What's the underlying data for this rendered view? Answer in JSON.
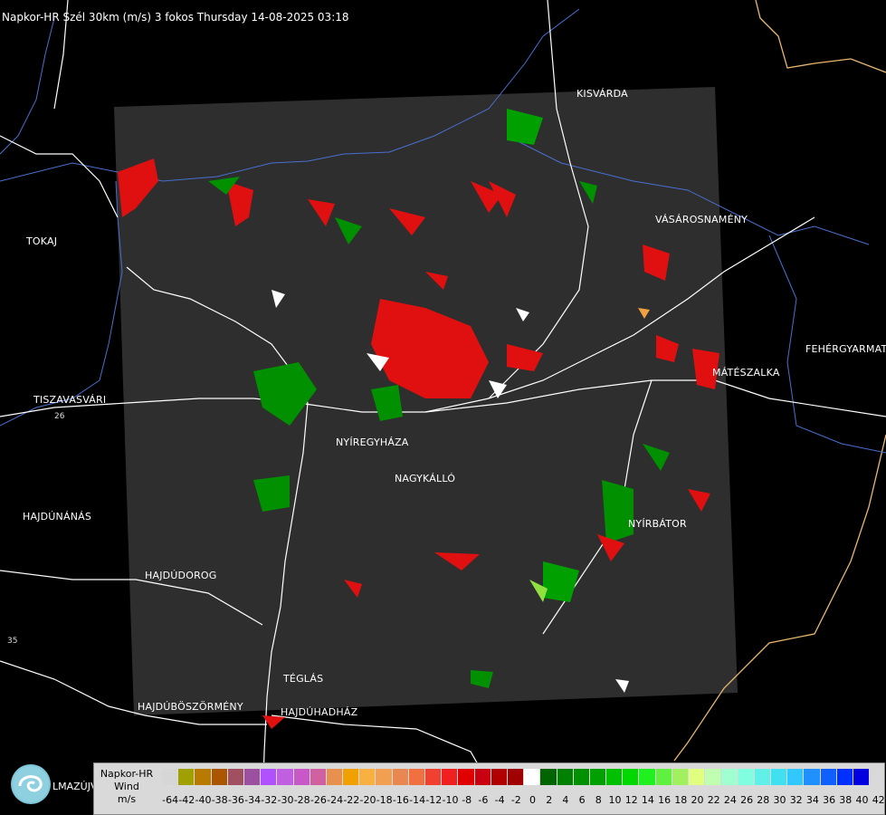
{
  "title": "Napkor-HR Szél 30km (m/s) 3 fokos Thursday 14-08-2025 03:18",
  "cities": [
    {
      "name": "KISVÁRDA"
    },
    {
      "name": "TOKAJ"
    },
    {
      "name": "VÁSÁROSNAMÉNY"
    },
    {
      "name": "FEHÉRGYARMAT"
    },
    {
      "name": "MÁTÉSZALKA"
    },
    {
      "name": "TISZAVASVÁRI"
    },
    {
      "name": "NYÍREGYHÁZA"
    },
    {
      "name": "NAGYKÁLLÓ"
    },
    {
      "name": "HAJDÚNÁNÁS"
    },
    {
      "name": "NYÍRBÁTOR"
    },
    {
      "name": "HAJDÚDOROG"
    },
    {
      "name": "TÉGLÁS"
    },
    {
      "name": "HAJDÚBÖSZÖRMÉNY"
    },
    {
      "name": "HAJDÚHADHÁZ"
    }
  ],
  "road_numbers": [
    "26",
    "35"
  ],
  "logo_text": "LMAZÚJVÁR",
  "legend": {
    "title_lines": [
      "Napkor-HR",
      "Wind",
      "m/s"
    ],
    "ticks": [
      "-64",
      "-42",
      "-40",
      "-38",
      "-36",
      "-34",
      "-32",
      "-30",
      "-28",
      "-26",
      "-24",
      "-22",
      "-20",
      "-18",
      "-16",
      "-14",
      "-12",
      "-10",
      "-8",
      "-6",
      "-4",
      "-2",
      "0",
      "2",
      "4",
      "6",
      "8",
      "10",
      "12",
      "14",
      "16",
      "18",
      "20",
      "22",
      "24",
      "26",
      "28",
      "30",
      "32",
      "34",
      "36",
      "38",
      "40",
      "42"
    ],
    "colors": [
      "#d6d6d6",
      "#a0a000",
      "#b87b00",
      "#aa5500",
      "#a05060",
      "#9b50a0",
      "#b050ff",
      "#c060e0",
      "#c858c8",
      "#d060a0",
      "#e89050",
      "#f0a000",
      "#f8b040",
      "#f0a050",
      "#e88850",
      "#f07040",
      "#f04030",
      "#f02020",
      "#e00000",
      "#c80010",
      "#b00000",
      "#a00000",
      "#ffffff",
      "#006400",
      "#008000",
      "#009000",
      "#00a000",
      "#00c000",
      "#00d800",
      "#20f020",
      "#60f040",
      "#a0f060",
      "#e0ff80",
      "#c0ffb0",
      "#a0ffd0",
      "#80ffe0",
      "#60f0e8",
      "#40e0f0",
      "#30c8ff",
      "#2090ff",
      "#1060ff",
      "#0030ff",
      "#0000e0"
    ]
  }
}
